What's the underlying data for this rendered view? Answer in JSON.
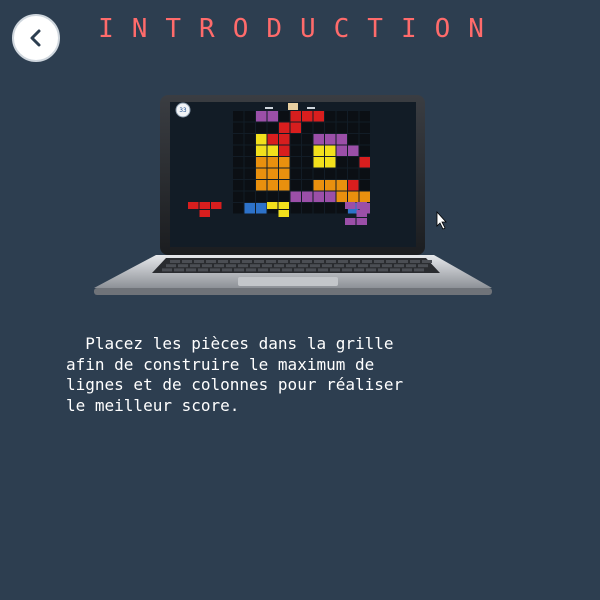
{
  "header": {
    "title": "INTRODUCTION",
    "back_button_icon": "chevron-left-icon"
  },
  "illustration": {
    "game_score": "33",
    "board_colors": {
      "red": "#d81e1e",
      "purple": "#9b4fa8",
      "yellow": "#f2e01c",
      "orange": "#e9900e",
      "blue": "#2d72c9",
      "empty": "#0b0f14"
    },
    "cursor_icon": "pointer-cursor-icon"
  },
  "intro": {
    "text": "  Placez les pièces dans la grille\nafin de construire le maximum de\nlignes et de colonnes pour réaliser\nle meilleur score."
  },
  "colors": {
    "background": "#2d3e50",
    "title": "#ff6b6b",
    "text": "#ffffff"
  }
}
